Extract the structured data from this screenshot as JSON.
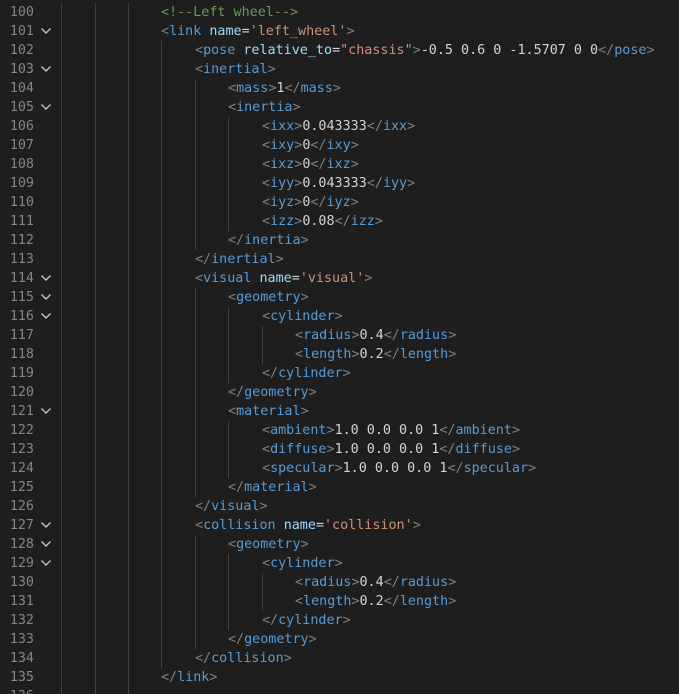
{
  "editor": {
    "fold_icon": "chevron-down-icon",
    "colors": {
      "background": "#1e1e1e",
      "line_number": "#858585",
      "tag": "#569cd6",
      "bracket": "#808080",
      "attribute": "#9cdcfe",
      "string": "#ce9178",
      "comment": "#6a9955",
      "text": "#d4d4d4"
    },
    "lines": [
      {
        "number": "100",
        "fold": false,
        "indent": 0,
        "tokens": [
          {
            "t": "cmt",
            "v": "<!--Left wheel-->"
          }
        ]
      },
      {
        "number": "101",
        "fold": true,
        "indent": 0,
        "tokens": [
          {
            "t": "br",
            "v": "<"
          },
          {
            "t": "tag",
            "v": "link"
          },
          {
            "t": "txt",
            "v": " "
          },
          {
            "t": "attr",
            "v": "name"
          },
          {
            "t": "txt",
            "v": "="
          },
          {
            "t": "str",
            "v": "'left_wheel'"
          },
          {
            "t": "br",
            "v": ">"
          }
        ]
      },
      {
        "number": "102",
        "fold": false,
        "indent": 1,
        "tokens": [
          {
            "t": "br",
            "v": "<"
          },
          {
            "t": "tag",
            "v": "pose"
          },
          {
            "t": "txt",
            "v": " "
          },
          {
            "t": "attr",
            "v": "relative_to"
          },
          {
            "t": "txt",
            "v": "="
          },
          {
            "t": "str",
            "v": "\"chassis\""
          },
          {
            "t": "br",
            "v": ">"
          },
          {
            "t": "txt",
            "v": "-0.5 0.6 0 -1.5707 0 0"
          },
          {
            "t": "br",
            "v": "</"
          },
          {
            "t": "tag",
            "v": "pose"
          },
          {
            "t": "br",
            "v": ">"
          }
        ]
      },
      {
        "number": "103",
        "fold": true,
        "indent": 1,
        "tokens": [
          {
            "t": "br",
            "v": "<"
          },
          {
            "t": "tag",
            "v": "inertial"
          },
          {
            "t": "br",
            "v": ">"
          }
        ]
      },
      {
        "number": "104",
        "fold": false,
        "indent": 2,
        "tokens": [
          {
            "t": "br",
            "v": "<"
          },
          {
            "t": "tag",
            "v": "mass"
          },
          {
            "t": "br",
            "v": ">"
          },
          {
            "t": "txt",
            "v": "1"
          },
          {
            "t": "br",
            "v": "</"
          },
          {
            "t": "tag",
            "v": "mass"
          },
          {
            "t": "br",
            "v": ">"
          }
        ]
      },
      {
        "number": "105",
        "fold": true,
        "indent": 2,
        "tokens": [
          {
            "t": "br",
            "v": "<"
          },
          {
            "t": "tag",
            "v": "inertia"
          },
          {
            "t": "br",
            "v": ">"
          }
        ]
      },
      {
        "number": "106",
        "fold": false,
        "indent": 3,
        "tokens": [
          {
            "t": "br",
            "v": "<"
          },
          {
            "t": "tag",
            "v": "ixx"
          },
          {
            "t": "br",
            "v": ">"
          },
          {
            "t": "txt",
            "v": "0.043333"
          },
          {
            "t": "br",
            "v": "</"
          },
          {
            "t": "tag",
            "v": "ixx"
          },
          {
            "t": "br",
            "v": ">"
          }
        ]
      },
      {
        "number": "107",
        "fold": false,
        "indent": 3,
        "tokens": [
          {
            "t": "br",
            "v": "<"
          },
          {
            "t": "tag",
            "v": "ixy"
          },
          {
            "t": "br",
            "v": ">"
          },
          {
            "t": "txt",
            "v": "0"
          },
          {
            "t": "br",
            "v": "</"
          },
          {
            "t": "tag",
            "v": "ixy"
          },
          {
            "t": "br",
            "v": ">"
          }
        ]
      },
      {
        "number": "108",
        "fold": false,
        "indent": 3,
        "tokens": [
          {
            "t": "br",
            "v": "<"
          },
          {
            "t": "tag",
            "v": "ixz"
          },
          {
            "t": "br",
            "v": ">"
          },
          {
            "t": "txt",
            "v": "0"
          },
          {
            "t": "br",
            "v": "</"
          },
          {
            "t": "tag",
            "v": "ixz"
          },
          {
            "t": "br",
            "v": ">"
          }
        ]
      },
      {
        "number": "109",
        "fold": false,
        "indent": 3,
        "tokens": [
          {
            "t": "br",
            "v": "<"
          },
          {
            "t": "tag",
            "v": "iyy"
          },
          {
            "t": "br",
            "v": ">"
          },
          {
            "t": "txt",
            "v": "0.043333"
          },
          {
            "t": "br",
            "v": "</"
          },
          {
            "t": "tag",
            "v": "iyy"
          },
          {
            "t": "br",
            "v": ">"
          }
        ]
      },
      {
        "number": "110",
        "fold": false,
        "indent": 3,
        "tokens": [
          {
            "t": "br",
            "v": "<"
          },
          {
            "t": "tag",
            "v": "iyz"
          },
          {
            "t": "br",
            "v": ">"
          },
          {
            "t": "txt",
            "v": "0"
          },
          {
            "t": "br",
            "v": "</"
          },
          {
            "t": "tag",
            "v": "iyz"
          },
          {
            "t": "br",
            "v": ">"
          }
        ]
      },
      {
        "number": "111",
        "fold": false,
        "indent": 3,
        "tokens": [
          {
            "t": "br",
            "v": "<"
          },
          {
            "t": "tag",
            "v": "izz"
          },
          {
            "t": "br",
            "v": ">"
          },
          {
            "t": "txt",
            "v": "0.08"
          },
          {
            "t": "br",
            "v": "</"
          },
          {
            "t": "tag",
            "v": "izz"
          },
          {
            "t": "br",
            "v": ">"
          }
        ]
      },
      {
        "number": "112",
        "fold": false,
        "indent": 2,
        "tokens": [
          {
            "t": "br",
            "v": "</"
          },
          {
            "t": "tag",
            "v": "inertia"
          },
          {
            "t": "br",
            "v": ">"
          }
        ]
      },
      {
        "number": "113",
        "fold": false,
        "indent": 1,
        "tokens": [
          {
            "t": "br",
            "v": "</"
          },
          {
            "t": "tag",
            "v": "inertial"
          },
          {
            "t": "br",
            "v": ">"
          }
        ]
      },
      {
        "number": "114",
        "fold": true,
        "indent": 1,
        "tokens": [
          {
            "t": "br",
            "v": "<"
          },
          {
            "t": "tag",
            "v": "visual"
          },
          {
            "t": "txt",
            "v": " "
          },
          {
            "t": "attr",
            "v": "name"
          },
          {
            "t": "txt",
            "v": "="
          },
          {
            "t": "str",
            "v": "'visual'"
          },
          {
            "t": "br",
            "v": ">"
          }
        ]
      },
      {
        "number": "115",
        "fold": true,
        "indent": 2,
        "tokens": [
          {
            "t": "br",
            "v": "<"
          },
          {
            "t": "tag",
            "v": "geometry"
          },
          {
            "t": "br",
            "v": ">"
          }
        ]
      },
      {
        "number": "116",
        "fold": true,
        "indent": 3,
        "tokens": [
          {
            "t": "br",
            "v": "<"
          },
          {
            "t": "tag",
            "v": "cylinder"
          },
          {
            "t": "br",
            "v": ">"
          }
        ]
      },
      {
        "number": "117",
        "fold": false,
        "indent": 4,
        "tokens": [
          {
            "t": "br",
            "v": "<"
          },
          {
            "t": "tag",
            "v": "radius"
          },
          {
            "t": "br",
            "v": ">"
          },
          {
            "t": "txt",
            "v": "0.4"
          },
          {
            "t": "br",
            "v": "</"
          },
          {
            "t": "tag",
            "v": "radius"
          },
          {
            "t": "br",
            "v": ">"
          }
        ]
      },
      {
        "number": "118",
        "fold": false,
        "indent": 4,
        "tokens": [
          {
            "t": "br",
            "v": "<"
          },
          {
            "t": "tag",
            "v": "length"
          },
          {
            "t": "br",
            "v": ">"
          },
          {
            "t": "txt",
            "v": "0.2"
          },
          {
            "t": "br",
            "v": "</"
          },
          {
            "t": "tag",
            "v": "length"
          },
          {
            "t": "br",
            "v": ">"
          }
        ]
      },
      {
        "number": "119",
        "fold": false,
        "indent": 3,
        "tokens": [
          {
            "t": "br",
            "v": "</"
          },
          {
            "t": "tag",
            "v": "cylinder"
          },
          {
            "t": "br",
            "v": ">"
          }
        ]
      },
      {
        "number": "120",
        "fold": false,
        "indent": 2,
        "tokens": [
          {
            "t": "br",
            "v": "</"
          },
          {
            "t": "tag",
            "v": "geometry"
          },
          {
            "t": "br",
            "v": ">"
          }
        ]
      },
      {
        "number": "121",
        "fold": true,
        "indent": 2,
        "tokens": [
          {
            "t": "br",
            "v": "<"
          },
          {
            "t": "tag",
            "v": "material"
          },
          {
            "t": "br",
            "v": ">"
          }
        ]
      },
      {
        "number": "122",
        "fold": false,
        "indent": 3,
        "tokens": [
          {
            "t": "br",
            "v": "<"
          },
          {
            "t": "tag",
            "v": "ambient"
          },
          {
            "t": "br",
            "v": ">"
          },
          {
            "t": "txt",
            "v": "1.0 0.0 0.0 1"
          },
          {
            "t": "br",
            "v": "</"
          },
          {
            "t": "tag",
            "v": "ambient"
          },
          {
            "t": "br",
            "v": ">"
          }
        ]
      },
      {
        "number": "123",
        "fold": false,
        "indent": 3,
        "tokens": [
          {
            "t": "br",
            "v": "<"
          },
          {
            "t": "tag",
            "v": "diffuse"
          },
          {
            "t": "br",
            "v": ">"
          },
          {
            "t": "txt",
            "v": "1.0 0.0 0.0 1"
          },
          {
            "t": "br",
            "v": "</"
          },
          {
            "t": "tag",
            "v": "diffuse"
          },
          {
            "t": "br",
            "v": ">"
          }
        ]
      },
      {
        "number": "124",
        "fold": false,
        "indent": 3,
        "tokens": [
          {
            "t": "br",
            "v": "<"
          },
          {
            "t": "tag",
            "v": "specular"
          },
          {
            "t": "br",
            "v": ">"
          },
          {
            "t": "txt",
            "v": "1.0 0.0 0.0 1"
          },
          {
            "t": "br",
            "v": "</"
          },
          {
            "t": "tag",
            "v": "specular"
          },
          {
            "t": "br",
            "v": ">"
          }
        ]
      },
      {
        "number": "125",
        "fold": false,
        "indent": 2,
        "tokens": [
          {
            "t": "br",
            "v": "</"
          },
          {
            "t": "tag",
            "v": "material"
          },
          {
            "t": "br",
            "v": ">"
          }
        ]
      },
      {
        "number": "126",
        "fold": false,
        "indent": 1,
        "tokens": [
          {
            "t": "br",
            "v": "</"
          },
          {
            "t": "tag",
            "v": "visual"
          },
          {
            "t": "br",
            "v": ">"
          }
        ]
      },
      {
        "number": "127",
        "fold": true,
        "indent": 1,
        "tokens": [
          {
            "t": "br",
            "v": "<"
          },
          {
            "t": "tag",
            "v": "collision"
          },
          {
            "t": "txt",
            "v": " "
          },
          {
            "t": "attr",
            "v": "name"
          },
          {
            "t": "txt",
            "v": "="
          },
          {
            "t": "str",
            "v": "'collision'"
          },
          {
            "t": "br",
            "v": ">"
          }
        ]
      },
      {
        "number": "128",
        "fold": true,
        "indent": 2,
        "tokens": [
          {
            "t": "br",
            "v": "<"
          },
          {
            "t": "tag",
            "v": "geometry"
          },
          {
            "t": "br",
            "v": ">"
          }
        ]
      },
      {
        "number": "129",
        "fold": true,
        "indent": 3,
        "tokens": [
          {
            "t": "br",
            "v": "<"
          },
          {
            "t": "tag",
            "v": "cylinder"
          },
          {
            "t": "br",
            "v": ">"
          }
        ]
      },
      {
        "number": "130",
        "fold": false,
        "indent": 4,
        "tokens": [
          {
            "t": "br",
            "v": "<"
          },
          {
            "t": "tag",
            "v": "radius"
          },
          {
            "t": "br",
            "v": ">"
          },
          {
            "t": "txt",
            "v": "0.4"
          },
          {
            "t": "br",
            "v": "</"
          },
          {
            "t": "tag",
            "v": "radius"
          },
          {
            "t": "br",
            "v": ">"
          }
        ]
      },
      {
        "number": "131",
        "fold": false,
        "indent": 4,
        "tokens": [
          {
            "t": "br",
            "v": "<"
          },
          {
            "t": "tag",
            "v": "length"
          },
          {
            "t": "br",
            "v": ">"
          },
          {
            "t": "txt",
            "v": "0.2"
          },
          {
            "t": "br",
            "v": "</"
          },
          {
            "t": "tag",
            "v": "length"
          },
          {
            "t": "br",
            "v": ">"
          }
        ]
      },
      {
        "number": "132",
        "fold": false,
        "indent": 3,
        "tokens": [
          {
            "t": "br",
            "v": "</"
          },
          {
            "t": "tag",
            "v": "cylinder"
          },
          {
            "t": "br",
            "v": ">"
          }
        ]
      },
      {
        "number": "133",
        "fold": false,
        "indent": 2,
        "tokens": [
          {
            "t": "br",
            "v": "</"
          },
          {
            "t": "tag",
            "v": "geometry"
          },
          {
            "t": "br",
            "v": ">"
          }
        ]
      },
      {
        "number": "134",
        "fold": false,
        "indent": 1,
        "tokens": [
          {
            "t": "br",
            "v": "</"
          },
          {
            "t": "tag",
            "v": "collision"
          },
          {
            "t": "br",
            "v": ">"
          }
        ]
      },
      {
        "number": "135",
        "fold": false,
        "indent": 0,
        "tokens": [
          {
            "t": "br",
            "v": "</"
          },
          {
            "t": "tag",
            "v": "link"
          },
          {
            "t": "br",
            "v": ">"
          }
        ]
      },
      {
        "number": "136",
        "fold": false,
        "indent": 0,
        "tokens": []
      }
    ]
  }
}
